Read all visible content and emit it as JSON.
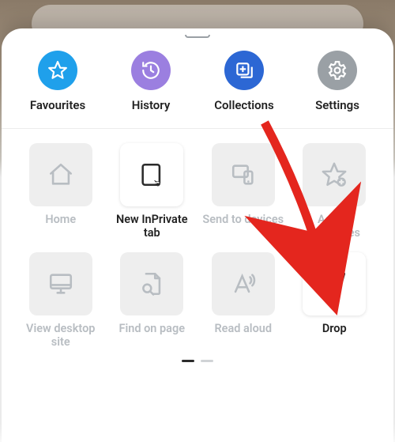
{
  "top": [
    {
      "name": "favourites",
      "label": "Favourites",
      "color": "blue",
      "icon": "star"
    },
    {
      "name": "history",
      "label": "History",
      "color": "purple",
      "icon": "history"
    },
    {
      "name": "collections",
      "label": "Collections",
      "color": "indigo",
      "icon": "collections"
    },
    {
      "name": "settings",
      "label": "Settings",
      "color": "grey",
      "icon": "gear"
    }
  ],
  "grid": [
    {
      "name": "home",
      "label": "Home",
      "icon": "home",
      "active": false
    },
    {
      "name": "new-inprivate",
      "label": "New InPrivate tab",
      "icon": "inprivate",
      "active": true
    },
    {
      "name": "send-devices",
      "label": "Send to devices",
      "icon": "send-device",
      "active": false
    },
    {
      "name": "add-favourites",
      "label": "Add to favourites",
      "icon": "star-add",
      "active": false
    },
    {
      "name": "view-desktop",
      "label": "View desktop site",
      "icon": "desktop",
      "active": false
    },
    {
      "name": "find-on-page",
      "label": "Find on page",
      "icon": "find",
      "active": false
    },
    {
      "name": "read-aloud",
      "label": "Read aloud",
      "icon": "read-aloud",
      "active": false
    },
    {
      "name": "drop",
      "label": "Drop",
      "icon": "send",
      "active": true
    }
  ],
  "pager": {
    "count": 2,
    "active": 0
  },
  "annotation": {
    "arrow_color": "#e4261e"
  }
}
